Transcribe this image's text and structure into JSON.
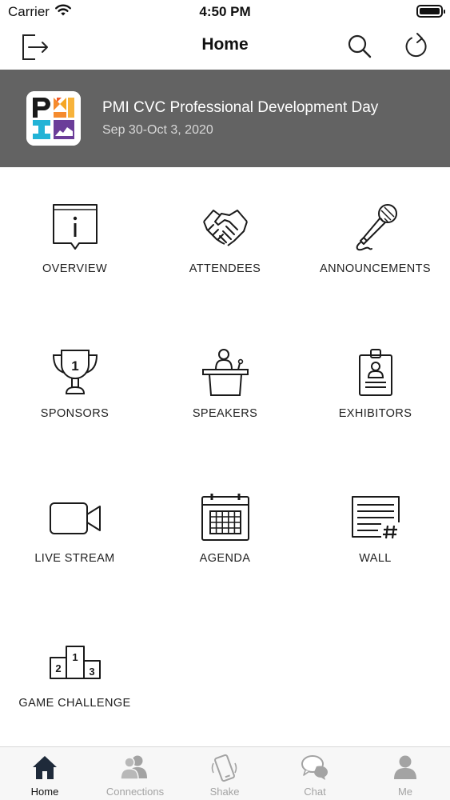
{
  "status_bar": {
    "carrier": "Carrier",
    "time": "4:50 PM"
  },
  "nav": {
    "title": "Home",
    "left_icon": "logout-icon",
    "right_icons": [
      "search-icon",
      "refresh-icon"
    ]
  },
  "event": {
    "title": "PMI CVC Professional Development Day",
    "dates": "Sep 30-Oct 3, 2020",
    "banner_color": "#636363"
  },
  "grid": [
    {
      "label": "OVERVIEW",
      "icon": "info-icon"
    },
    {
      "label": "ATTENDEES",
      "icon": "handshake-icon"
    },
    {
      "label": "ANNOUNCEMENTS",
      "icon": "microphone-icon"
    },
    {
      "label": "SPONSORS",
      "icon": "trophy-icon"
    },
    {
      "label": "SPEAKERS",
      "icon": "speaker-podium-icon"
    },
    {
      "label": "EXHIBITORS",
      "icon": "badge-icon"
    },
    {
      "label": "LIVE STREAM",
      "icon": "video-camera-icon"
    },
    {
      "label": "AGENDA",
      "icon": "calendar-icon"
    },
    {
      "label": "WALL",
      "icon": "wall-post-icon"
    },
    {
      "label": "GAME CHALLENGE",
      "icon": "podium-icon"
    }
  ],
  "tabs": [
    {
      "label": "Home",
      "icon": "home-icon",
      "active": true
    },
    {
      "label": "Connections",
      "icon": "connections-icon",
      "active": false
    },
    {
      "label": "Shake",
      "icon": "shake-phone-icon",
      "active": false
    },
    {
      "label": "Chat",
      "icon": "chat-icon",
      "active": false
    },
    {
      "label": "Me",
      "icon": "person-icon",
      "active": false
    }
  ],
  "colors": {
    "active_tab": "#111111",
    "inactive_tab": "#a3a3a3"
  }
}
